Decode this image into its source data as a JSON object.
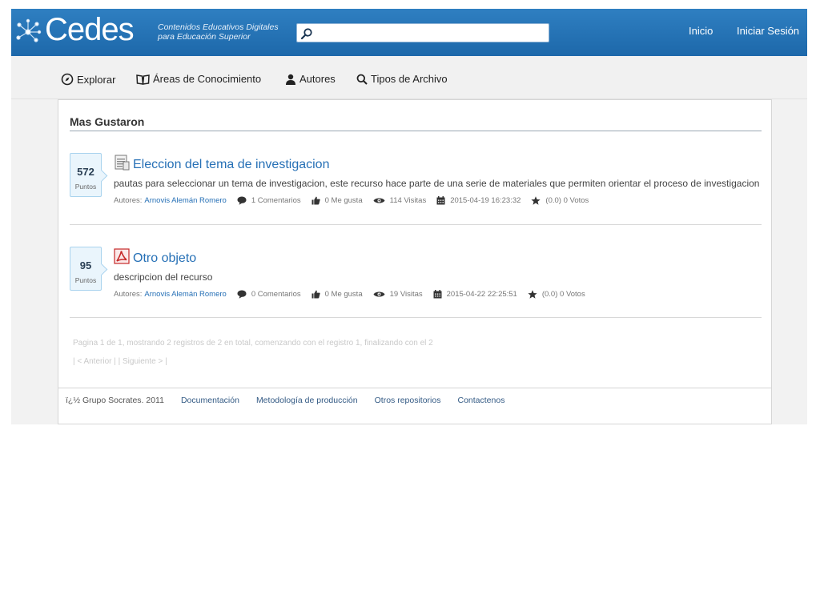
{
  "header": {
    "logo_text": "Cedes",
    "tagline_line1": "Contenidos Educativos Digitales",
    "tagline_line2": "para Educación Superior",
    "search": {
      "placeholder": "",
      "value": ""
    },
    "links": {
      "home": "Inicio",
      "login": "Iniciar Sesión"
    }
  },
  "nav": {
    "explore": "Explorar",
    "areas": "Áreas de Conocimiento",
    "authors": "Autores",
    "file_types": "Tipos de Archivo"
  },
  "main": {
    "section_title": "Mas Gustaron",
    "items": [
      {
        "points": "572",
        "points_label": "Puntos",
        "icon": "document-icon",
        "title": "Eleccion del tema de investigacion",
        "description": "pautas para seleccionar un tema de investigacion, este recurso hace parte de una serie de materiales que permiten orientar el proceso de investigacion",
        "authors_label": "Autores:",
        "author": "Arnovis Alemán Romero",
        "comments": "1 Comentarios",
        "likes": "0 Me gusta",
        "visits": "114 Visitas",
        "date": "2015-04-19 16:23:32",
        "votes": "(0.0) 0 Votos"
      },
      {
        "points": "95",
        "points_label": "Puntos",
        "icon": "pdf-icon",
        "title": "Otro objeto",
        "description": "descripcion del recurso",
        "authors_label": "Autores:",
        "author": "Arnovis Alemán Romero",
        "comments": "0 Comentarios",
        "likes": "0 Me gusta",
        "visits": "19 Visitas",
        "date": "2015-04-22 22:25:51",
        "votes": "(0.0) 0 Votos"
      }
    ],
    "pager": {
      "info": "Pagina 1 de 1, mostrando 2 registros de 2 en total, comenzando con el registro 1, finalizando con el 2",
      "links": "| < Anterior | | Siguiente > |"
    }
  },
  "footer": {
    "copyright": "ï¿½ Grupo Socrates. 2011",
    "links": [
      "Documentación",
      "Metodología de producción",
      "Otros repositorios",
      "Contactenos"
    ]
  },
  "colors": {
    "header_blue": "#1d68aa",
    "link_blue": "#2670b6",
    "points_bg": "#eaf5fc"
  }
}
